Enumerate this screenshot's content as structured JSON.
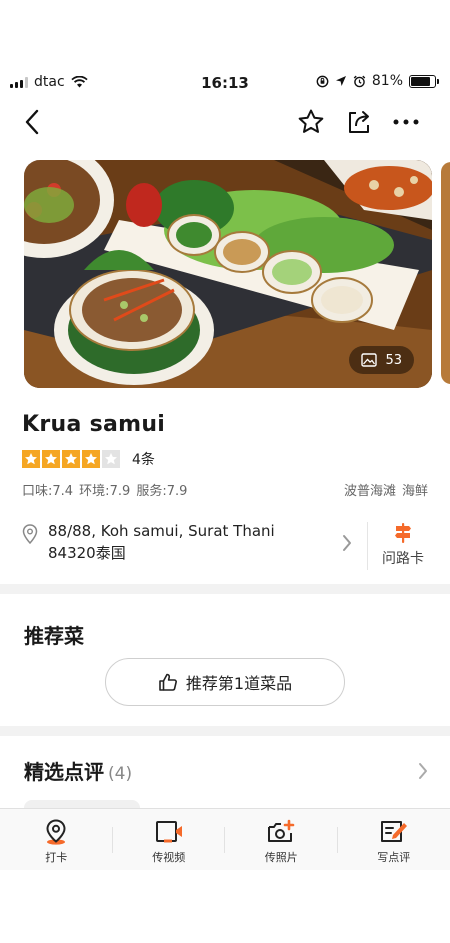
{
  "status_bar": {
    "carrier": "dtac",
    "time": "16:13",
    "battery": "81%",
    "battery_level": 0.81
  },
  "nav": {
    "icons": [
      "back-icon",
      "star-outline-icon",
      "share-icon",
      "more-icon"
    ]
  },
  "hero": {
    "photo_count": "53",
    "icon": "image-icon"
  },
  "restaurant": {
    "name": "Krua samui",
    "rating": 4,
    "max_rating": 5,
    "review_count": "4条",
    "scores": "口味:7.4 环境:7.9 服务:7.9",
    "tags": [
      "波普海滩",
      "海鲜"
    ],
    "address_line1": "88/88, Koh samui, Surat Thani",
    "address_line2": "84320泰国",
    "route_label": "问路卡"
  },
  "recommended": {
    "title": "推荐菜",
    "button_label": "推荐第1道菜品"
  },
  "reviews": {
    "title": "精选点评",
    "count": "(4)"
  },
  "tab_bar": {
    "items": [
      {
        "label": "打卡",
        "icon": "location-pin-icon"
      },
      {
        "label": "传视频",
        "icon": "video-upload-icon"
      },
      {
        "label": "传照片",
        "icon": "camera-add-icon"
      },
      {
        "label": "写点评",
        "icon": "write-review-icon"
      }
    ]
  },
  "colors": {
    "accent": "#f56a2a",
    "star": "#f5a623",
    "text": "#1a1a1a",
    "muted": "#666666",
    "band": "#f2f2f2"
  }
}
